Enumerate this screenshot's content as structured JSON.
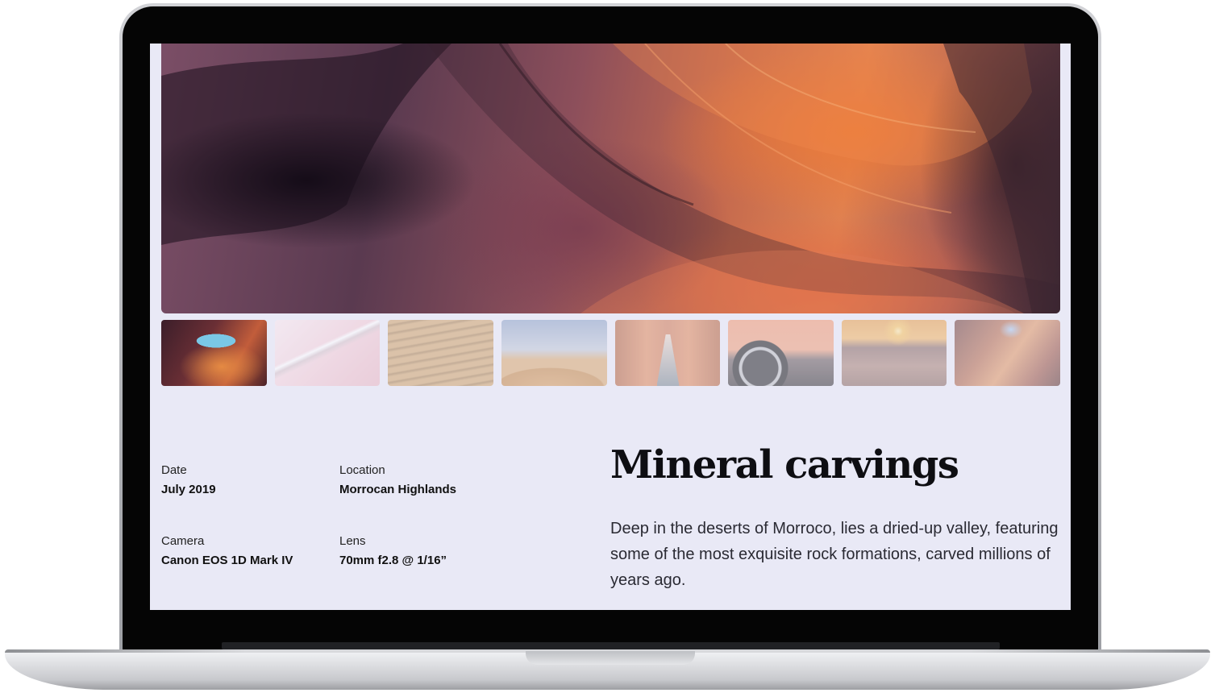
{
  "gallery": {
    "title": "Mineral carvings",
    "description": "Deep in the deserts of Morroco, lies a dried-up valley, featuring some of the most exquisite rock formations, carved millions of years ago.",
    "meta": {
      "date": {
        "label": "Date",
        "value": "July 2019"
      },
      "location": {
        "label": "Location",
        "value": "Morrocan Highlands"
      },
      "camera": {
        "label": "Camera",
        "value": "Canon EOS 1D Mark IV"
      },
      "lens": {
        "label": "Lens",
        "value": "70mm f2.8 @ 1/16”"
      }
    },
    "thumbnails": [
      {
        "name": "canyon-arch",
        "state": "selected"
      },
      {
        "name": "pink-escalator",
        "state": "inactive"
      },
      {
        "name": "sand-ripples",
        "state": "inactive"
      },
      {
        "name": "desert-dune",
        "state": "inactive"
      },
      {
        "name": "orange-corridor",
        "state": "inactive"
      },
      {
        "name": "car-wheel",
        "state": "inactive"
      },
      {
        "name": "desert-sunset",
        "state": "inactive"
      },
      {
        "name": "canyon-walls",
        "state": "inactive"
      }
    ]
  }
}
